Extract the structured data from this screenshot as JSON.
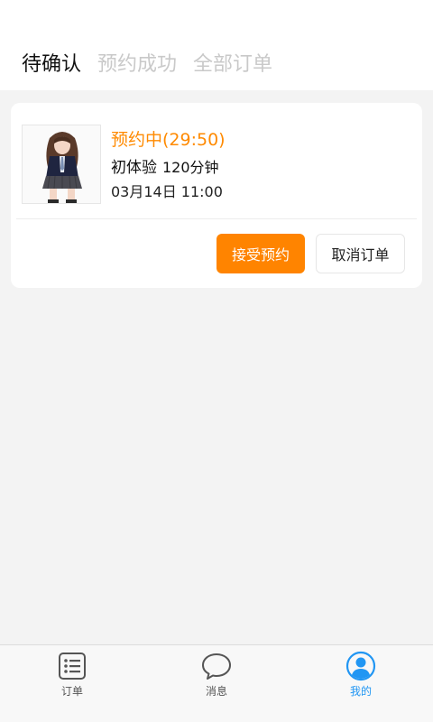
{
  "tabs": [
    {
      "label": "待确认",
      "active": true
    },
    {
      "label": "预约成功",
      "active": false
    },
    {
      "label": "全部订单",
      "active": false
    }
  ],
  "order": {
    "status": "预约中(29:50)",
    "service": "初体验",
    "duration": "120分钟",
    "datetime": "03月14日 11:00",
    "accept_label": "接受预约",
    "cancel_label": "取消订单"
  },
  "bottom_nav": [
    {
      "label": "订单",
      "icon": "list-icon",
      "active": false
    },
    {
      "label": "消息",
      "icon": "chat-bubble-icon",
      "active": false
    },
    {
      "label": "我的",
      "icon": "user-icon",
      "active": true
    }
  ],
  "colors": {
    "accent": "#ff8400",
    "active_nav": "#2196f3"
  }
}
